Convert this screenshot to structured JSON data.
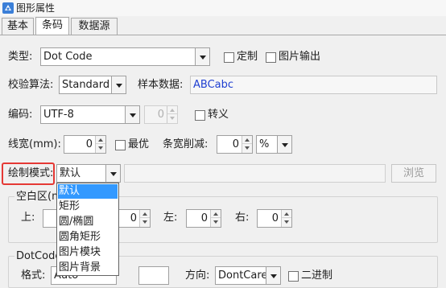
{
  "window": {
    "title": "图形属性"
  },
  "tabs": [
    {
      "label": "基本",
      "active": false
    },
    {
      "label": "条码",
      "active": true
    },
    {
      "label": "数据源",
      "active": false
    }
  ],
  "barcode": {
    "type_label": "类型:",
    "type_value": "Dot Code",
    "custom_label": "定制",
    "image_output_label": "图片输出",
    "check_algorithm_label": "校验算法:",
    "check_algorithm_value": "Standard",
    "sample_data_label": "样本数据:",
    "sample_data_value": "ABCabc",
    "encoding_label": "编码:",
    "encoding_value": "UTF-8",
    "encoding_number": "0",
    "escape_label": "转义",
    "line_width_label": "线宽(mm):",
    "line_width_value": "0",
    "optimal_label": "最优",
    "bar_width_reduction_label": "条宽削减:",
    "bar_width_reduction_value": "0",
    "reduction_unit": "%",
    "draw_mode_label": "绘制模式:",
    "draw_mode_value": "默认",
    "browse_label": "浏览"
  },
  "quiet_zone": {
    "legend": "空白区(mm",
    "top_label": "上:",
    "bottom_value": "0",
    "left_label": "左:",
    "left_value": "0",
    "right_label": "右:",
    "right_value": "0"
  },
  "dotcode_group": {
    "legend": "DotCode",
    "format_label": "格式:",
    "format_value": "Auto",
    "direction_label": "方向:",
    "direction_value": "DontCare",
    "binary_label": "二进制"
  },
  "draw_mode_options": [
    "默认",
    "矩形",
    "圆/椭圆",
    "圆角矩形",
    "图片模块",
    "图片背景"
  ],
  "selected_draw_mode_index": 0,
  "colors": {
    "sample_data_text": "#1f3fd1",
    "selection_highlight": "#3399ff",
    "annotation_box": "#e53935"
  }
}
